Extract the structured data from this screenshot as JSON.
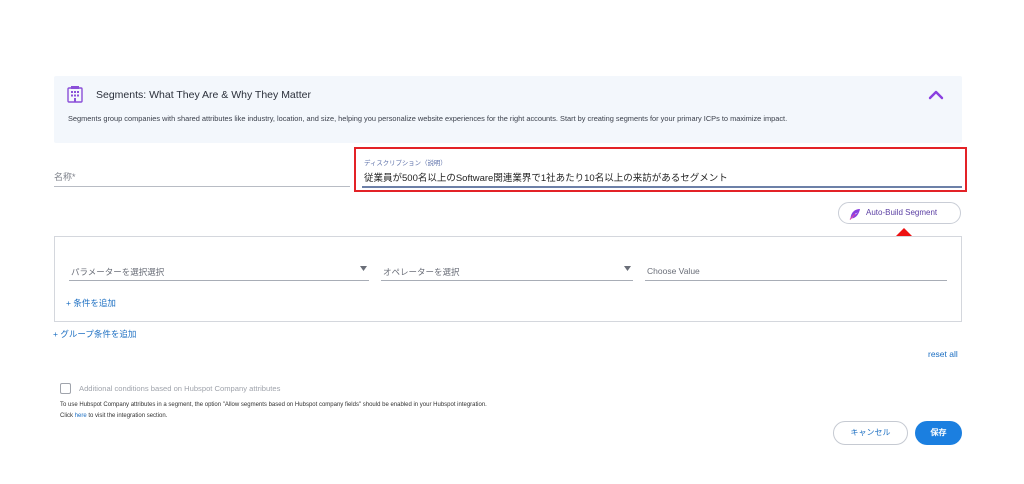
{
  "info": {
    "icon": "building-icon",
    "title": "Segments: What They Are & Why They Matter",
    "description": "Segments group companies with shared attributes like industry, location, and size, helping you personalize website experiences for the right accounts. Start by creating segments for your primary ICPs to maximize impact.",
    "collapse_icon": "chevron-up-icon"
  },
  "form": {
    "name_placeholder": "名称*",
    "name_value": "",
    "description_label": "ディスクリプション（説明）",
    "description_value": "従業員が500名以上のSoftware関連業界で1社あたり10名以上の来訪があるセグメント"
  },
  "auto_build": {
    "label": "Auto-Build Segment",
    "icon": "feather-icon"
  },
  "conditions": {
    "parameter_placeholder": "パラメーターを選択選択",
    "operator_placeholder": "オペレーターを選択",
    "value_placeholder": "Choose Value",
    "add_condition": "+ 条件を追加"
  },
  "add_group": "+ グループ条件を追加",
  "reset_all": "reset all",
  "hubspot": {
    "checkbox_label": "Additional conditions based on Hubspot Company attributes",
    "checked": false,
    "note_line1": "To use Hubspot Company attributes in a segment, the option \"Allow segments based on Hubspot company fields\" should be enabled in your Hubspot integration.",
    "note_line2_prefix": "Click ",
    "note_line2_link": "here",
    "note_line2_suffix": " to visit the integration section."
  },
  "actions": {
    "cancel": "キャンセル",
    "save": "保存"
  },
  "colors": {
    "accent": "#1b7fe0",
    "link": "#1b6ec2",
    "highlight": "#e32227",
    "purple": "#7b4fd1",
    "info_bg": "#f3f7fc"
  }
}
